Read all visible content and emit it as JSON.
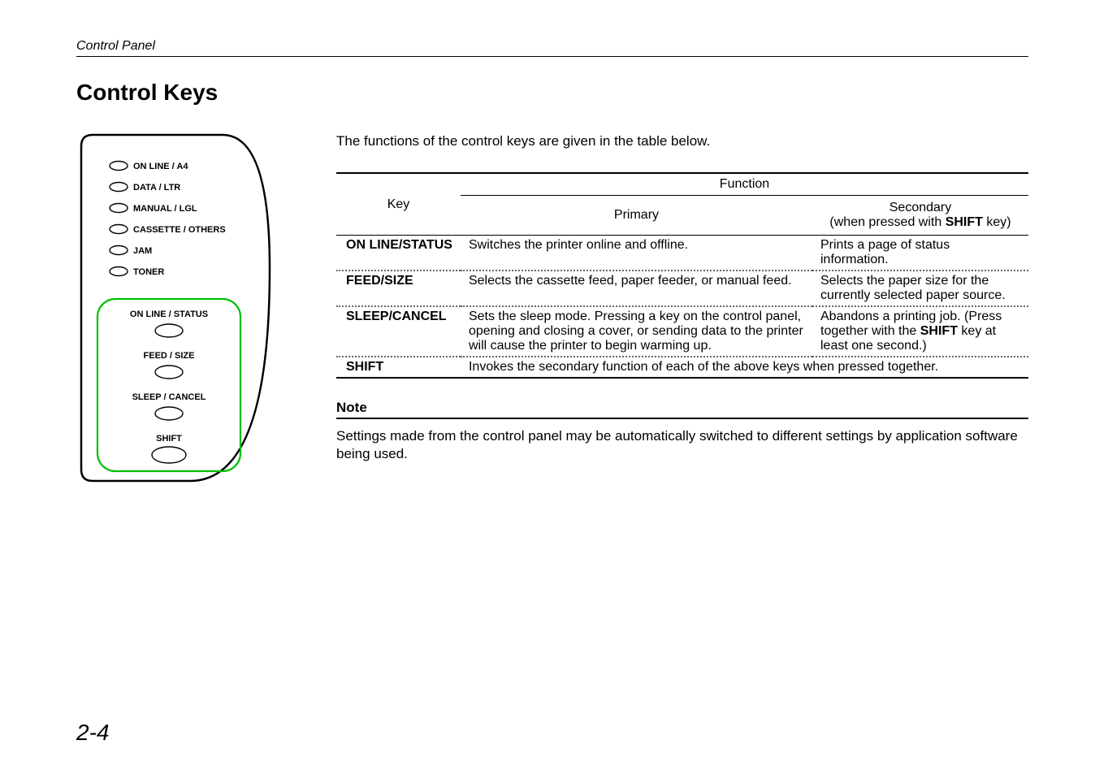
{
  "header_section": "Control Panel",
  "title": "Control Keys",
  "intro": "The functions of the control keys are given in the table below.",
  "panel": {
    "leds": [
      {
        "label": "ON LINE / A4"
      },
      {
        "label": "DATA / LTR"
      },
      {
        "label": "MANUAL / LGL"
      },
      {
        "label": "CASSETTE / OTHERS"
      },
      {
        "label": "JAM"
      },
      {
        "label": "TONER"
      }
    ],
    "keys": [
      {
        "label": "ON LINE / STATUS"
      },
      {
        "label": "FEED / SIZE"
      },
      {
        "label": "SLEEP / CANCEL"
      },
      {
        "label": "SHIFT"
      }
    ]
  },
  "table": {
    "head": {
      "key": "Key",
      "function": "Function",
      "primary": "Primary",
      "secondary_line1": "Secondary",
      "secondary_line2_pre": "(when pressed with ",
      "secondary_line2_bold": "SHIFT",
      "secondary_line2_post": " key)"
    },
    "rows": [
      {
        "key": "ON LINE/STATUS",
        "primary": "Switches the printer online and offline.",
        "secondary": "Prints a page of status information."
      },
      {
        "key": "FEED/SIZE",
        "primary": "Selects the cassette feed, paper feeder, or manual feed.",
        "secondary": "Selects the paper size for the currently selected paper source."
      },
      {
        "key": "SLEEP/CANCEL",
        "primary": "Sets the sleep mode. Pressing a key on the control panel, opening and closing a cover, or sending data to the printer will cause the printer to begin warming up.",
        "secondary_pre": "Abandons a printing job. (Press together with the ",
        "secondary_bold": "SHIFT",
        "secondary_post": " key at least one second.)"
      },
      {
        "key": "SHIFT",
        "merged": "Invokes the secondary function of each of the above keys when pressed together."
      }
    ]
  },
  "note_heading": "Note",
  "note_body": "Settings made from the control panel may be automatically switched to different settings by application software being used.",
  "page_number": "2-4"
}
